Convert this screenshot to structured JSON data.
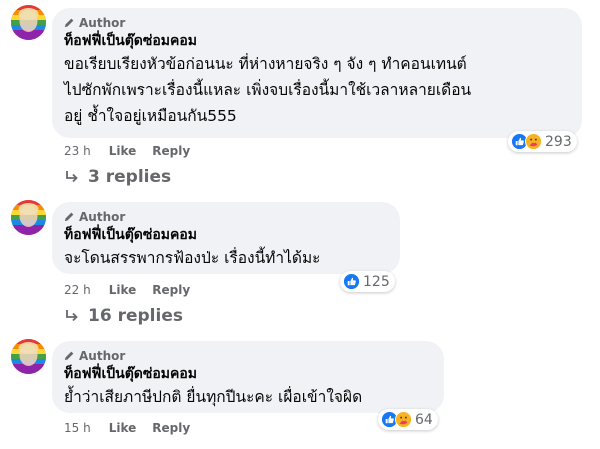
{
  "comments": [
    {
      "badge": "Author",
      "name": "ท็อฟฟี่เป็นตุ๊ดซ่อมคอม",
      "lines": [
        "ขอเรียบเรียงหัวข้อก่อนนะ ที่ห่างหายจริง ๆ จัง ๆ ทำคอนเทนต์",
        "ไปซักพักเพราะเรื่องนี้แหละ เพิ่งจบเรื่องนี้มาใช้เวลาหลายเดือน",
        "อยู่ ช้ำใจอยู่เหมือนกัน555"
      ],
      "time": "23 h",
      "like": "Like",
      "reply": "Reply",
      "reaction_count": "293",
      "replies": "3 replies"
    },
    {
      "badge": "Author",
      "name": "ท็อฟฟี่เป็นตุ๊ดซ่อมคอม",
      "lines": [
        "จะโดนสรรพากรฟ้องป่ะ เรื่องนี้ทำได้มะ"
      ],
      "time": "22 h",
      "like": "Like",
      "reply": "Reply",
      "reaction_count": "125",
      "replies": "16 replies"
    },
    {
      "badge": "Author",
      "name": "ท็อฟฟี่เป็นตุ๊ดซ่อมคอม",
      "lines": [
        "ย้ำว่าเสียภาษีปกติ ยื่นทุกปีนะคะ เผื่อเข้าใจผิด"
      ],
      "time": "15 h",
      "like": "Like",
      "reply": "Reply",
      "reaction_count": "64"
    }
  ],
  "icons": {
    "badge": "pencil-icon",
    "like_reaction": "like-reaction-icon",
    "care_reaction": "care-reaction-icon",
    "replies": "reply-arrow-icon"
  },
  "colors": {
    "bubble": "#f0f2f5",
    "meta_text": "#65676b",
    "like_blue": "#1877f2",
    "care_yellow": "#f7b125"
  }
}
